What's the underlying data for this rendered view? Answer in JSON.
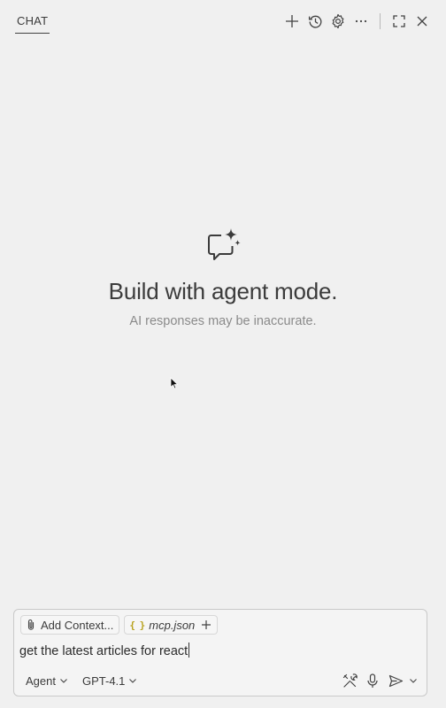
{
  "header": {
    "tab_label": "CHAT",
    "toolbar_icons": [
      "plus-icon",
      "history-icon",
      "gear-icon",
      "more-icon",
      "maximize-icon",
      "close-icon"
    ]
  },
  "welcome": {
    "icon": "chat-sparkle-icon",
    "title": "Build with agent mode.",
    "subtitle": "AI responses may be inaccurate."
  },
  "input": {
    "add_context_label": "Add Context...",
    "attached_file": "mcp.json",
    "attached_file_icon": "json-braces-icon",
    "prompt_text": "get the latest articles for react",
    "mode_label": "Agent",
    "model_label": "GPT-4.1",
    "action_icons": [
      "tools-icon",
      "mic-icon",
      "send-icon",
      "chevron-down-icon"
    ]
  },
  "colors": {
    "background": "#f0f0f0",
    "text": "#3b3b3b",
    "muted_text": "#8a8a8a",
    "json_icon": "#b8a21e",
    "border": "#c9c9c9"
  }
}
